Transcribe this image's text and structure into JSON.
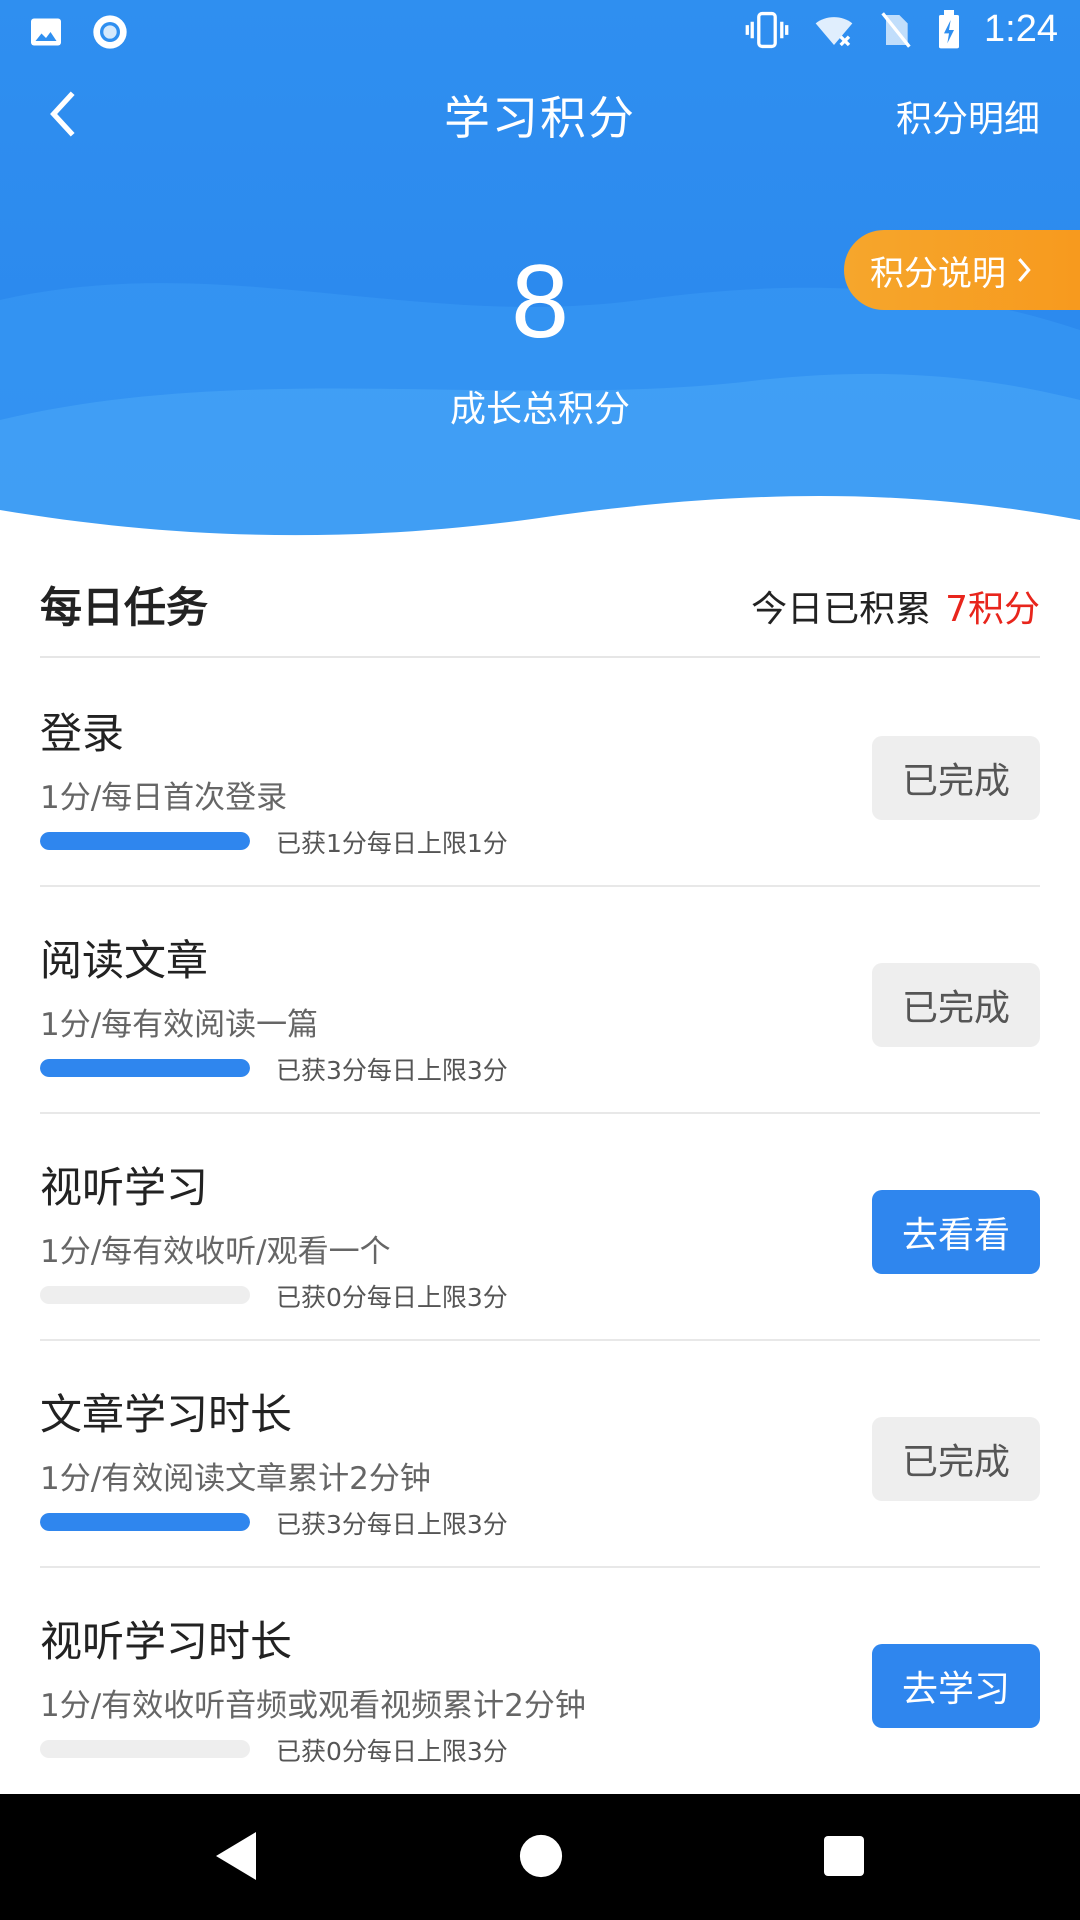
{
  "status_bar": {
    "time": "1:24"
  },
  "navbar": {
    "title": "学习积分",
    "detail_link": "积分明细"
  },
  "summary": {
    "explain_button": "积分说明",
    "total_points": "8",
    "total_label": "成长总积分"
  },
  "daily": {
    "title": "每日任务",
    "today_prefix": "今日已积累",
    "today_points": "7积分"
  },
  "tasks": [
    {
      "title": "登录",
      "desc": "1分/每日首次登录",
      "progress_text": "已获1分每日上限1分",
      "progress": 1.0,
      "button": "已完成",
      "state": "done"
    },
    {
      "title": "阅读文章",
      "desc": "1分/每有效阅读一篇",
      "progress_text": "已获3分每日上限3分",
      "progress": 1.0,
      "button": "已完成",
      "state": "done"
    },
    {
      "title": "视听学习",
      "desc": "1分/每有效收听/观看一个",
      "progress_text": "已获0分每日上限3分",
      "progress": 0.0,
      "button": "去看看",
      "state": "go"
    },
    {
      "title": "文章学习时长",
      "desc": "1分/有效阅读文章累计2分钟",
      "progress_text": "已获3分每日上限3分",
      "progress": 1.0,
      "button": "已完成",
      "state": "done"
    },
    {
      "title": "视听学习时长",
      "desc": "1分/有效收听音频或观看视频累计2分钟",
      "progress_text": "已获0分每日上限3分",
      "progress": 0.0,
      "button": "去学习",
      "state": "go"
    }
  ],
  "colors": {
    "primary": "#2f86ee",
    "accent_orange": "#f6a62c",
    "highlight_red": "#e8251c"
  },
  "icons": {
    "status_left": [
      "image-icon",
      "record-icon"
    ],
    "status_right": [
      "vibrate-icon",
      "wifi-off-icon",
      "no-sim-icon",
      "battery-charging-icon"
    ],
    "nav_back": "chevron-left-icon",
    "system_nav": [
      "back-triangle-icon",
      "home-circle-icon",
      "recents-square-icon"
    ]
  }
}
